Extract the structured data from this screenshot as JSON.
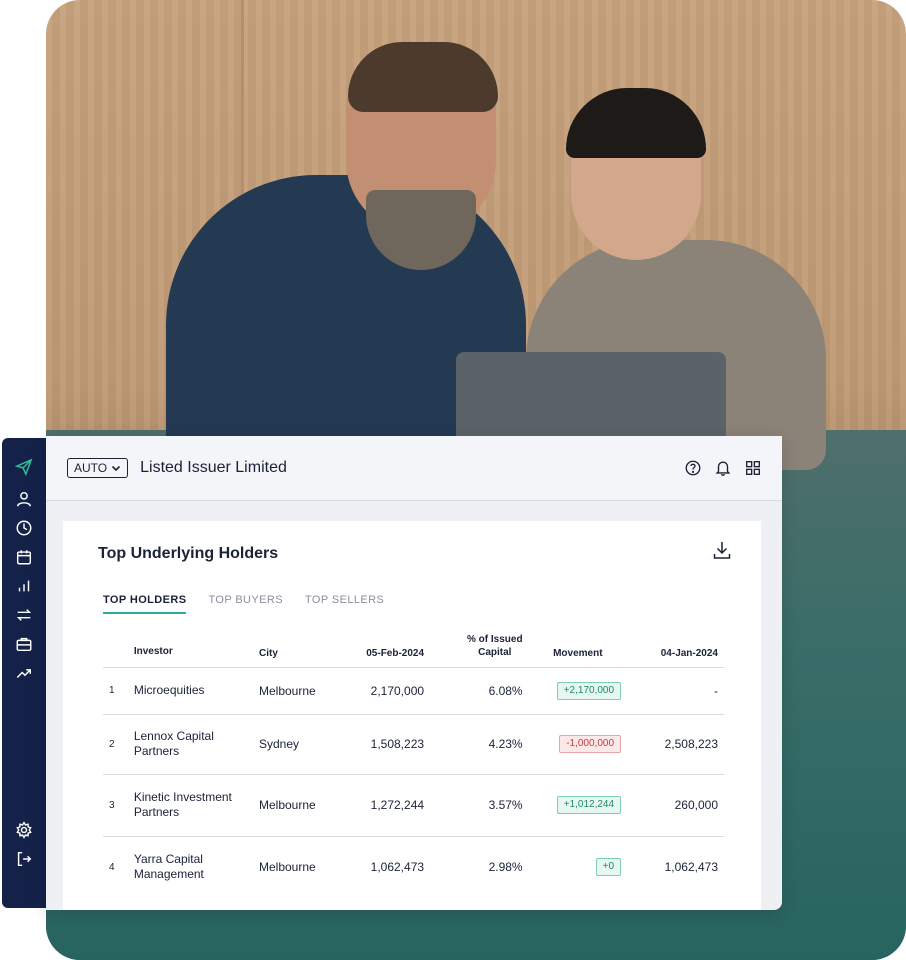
{
  "header": {
    "auto_label": "AUTO",
    "issuer_name": "Listed Issuer Limited"
  },
  "sidebar": {
    "items": [
      {
        "icon": "logo-icon"
      },
      {
        "icon": "user-icon"
      },
      {
        "icon": "clock-icon"
      },
      {
        "icon": "calendar-icon"
      },
      {
        "icon": "bar-chart-icon"
      },
      {
        "icon": "transfer-icon"
      },
      {
        "icon": "briefcase-icon"
      },
      {
        "icon": "trend-icon"
      },
      {
        "icon": "gear-icon"
      },
      {
        "icon": "logout-icon"
      }
    ]
  },
  "card": {
    "title": "Top Underlying Holders",
    "tabs": [
      {
        "label": "TOP HOLDERS",
        "active": true
      },
      {
        "label": "TOP BUYERS",
        "active": false
      },
      {
        "label": "TOP SELLERS",
        "active": false
      }
    ],
    "columns": {
      "investor": "Investor",
      "city": "City",
      "current": "05-Feb-2024",
      "pct_line1": "% of Issued",
      "pct_line2": "Capital",
      "movement": "Movement",
      "previous": "04-Jan-2024"
    },
    "rows": [
      {
        "rank": "1",
        "investor_l1": "Microequities",
        "investor_l2": "",
        "city": "Melbourne",
        "current": "2,170,000",
        "pct": "6.08%",
        "movement": "+2,170,000",
        "movement_type": "pos",
        "previous": "-"
      },
      {
        "rank": "2",
        "investor_l1": "Lennox Capital",
        "investor_l2": "Partners",
        "city": "Sydney",
        "current": "1,508,223",
        "pct": "4.23%",
        "movement": "-1,000,000",
        "movement_type": "neg",
        "previous": "2,508,223"
      },
      {
        "rank": "3",
        "investor_l1": "Kinetic Investment",
        "investor_l2": "Partners",
        "city": "Melbourne",
        "current": "1,272,244",
        "pct": "3.57%",
        "movement": "+1,012,244",
        "movement_type": "pos",
        "previous": "260,000"
      },
      {
        "rank": "4",
        "investor_l1": "Yarra Capital",
        "investor_l2": "Management",
        "city": "Melbourne",
        "current": "1,062,473",
        "pct": "2.98%",
        "movement": "+0",
        "movement_type": "pos",
        "previous": "1,062,473"
      }
    ]
  },
  "colors": {
    "sidebar_bg": "#14224a",
    "accent": "#2fa99a",
    "positive": "#1f8a6a",
    "negative": "#c23d3d"
  }
}
